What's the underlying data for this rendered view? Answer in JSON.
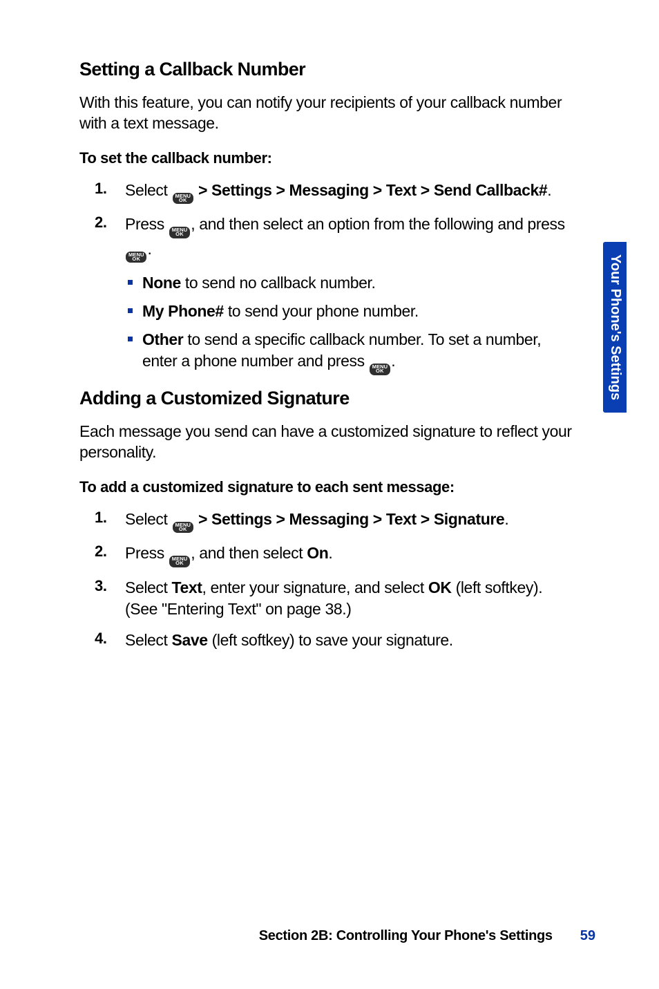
{
  "menu_key": {
    "line1": "MENU",
    "line2": "OK"
  },
  "side_tab": "Your Phone's Settings",
  "footer": {
    "section": "Section 2B: Controlling Your Phone's Settings",
    "page": "59"
  },
  "s1": {
    "heading": "Setting a Callback Number",
    "intro": "With this feature, you can notify your recipients of your callback number with a text message.",
    "subhead": "To set the callback number:",
    "step1": {
      "num": "1.",
      "prefix": "Select ",
      "nav": " > Settings > Messaging > Text > Send Callback#",
      "suffix": "."
    },
    "step2": {
      "num": "2.",
      "part1": "Press ",
      "part2": ", and then select an option from the following and press ",
      "part3": "."
    },
    "bullets": {
      "b1": {
        "label": "None",
        "text": " to send no callback number."
      },
      "b2": {
        "label": "My Phone#",
        "text": " to send your phone number."
      },
      "b3": {
        "label": "Other",
        "text_a": " to send a specific callback number. To set a number, enter a phone number and press ",
        "text_b": "."
      }
    }
  },
  "s2": {
    "heading": "Adding a Customized Signature",
    "intro": "Each message you send can have a customized signature to reflect your personality.",
    "subhead": "To add a customized signature to each sent message:",
    "step1": {
      "num": "1.",
      "prefix": "Select ",
      "nav": " > Settings > Messaging > Text > Signature",
      "suffix": "."
    },
    "step2": {
      "num": "2.",
      "part1": "Press ",
      "part2": ", and then select ",
      "on": "On",
      "part3": "."
    },
    "step3": {
      "num": "3.",
      "t1": "Select ",
      "b1": "Text",
      "t2": ", enter your signature, and select ",
      "b2": "OK",
      "t3": " (left softkey). (See \"Entering Text\" on page 38.)"
    },
    "step4": {
      "num": "4.",
      "t1": "Select ",
      "b1": "Save",
      "t2": " (left softkey) to save your signature."
    }
  }
}
